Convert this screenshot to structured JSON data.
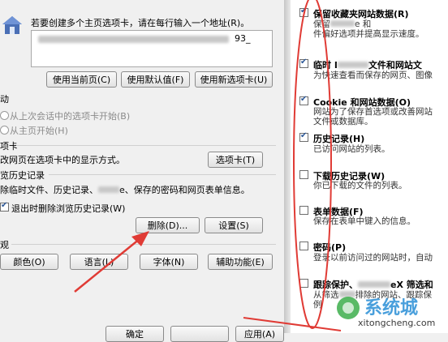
{
  "left": {
    "home_text": "若要创建多个主页选项卡，请在每行输入一个地址(R)。",
    "url_suffix": "93_",
    "btn_current": "使用当前页(C)",
    "btn_default": "使用默认值(F)",
    "btn_newtab": "使用新选项卡(U)",
    "startup_head": "动",
    "startup_opt1": "从上次会话中的选项卡开始(B)",
    "startup_opt2": "从主页开始(H)",
    "tabs_head": "项卡",
    "tabs_desc": "改网页在选项卡中的显示方式。",
    "btn_tabs": "选项卡(T)",
    "history_head": "览历史记录",
    "history_desc_a": "除临时文件、历史记录、",
    "history_desc_b": "e、保存的密码和网页表单信息。",
    "delete_on_exit": "退出时删除浏览历史记录(W)",
    "btn_delete": "删除(D)...",
    "btn_settings": "设置(S)",
    "appearance_head": "观",
    "btn_color": "颜色(O)",
    "btn_language": "语言(L)",
    "btn_font": "字体(N)",
    "btn_access": "辅助功能(E)",
    "btn_ok": "确定",
    "btn_apply": "应用(A)"
  },
  "right": {
    "items": [
      {
        "title": "保留收藏夹网站数据(R)",
        "desc": [
          "保留",
          "e 和",
          "件偏好选项并提高显示速度。"
        ],
        "checked": true
      },
      {
        "title_a": "临时 I",
        "title_b": "文件和网站文",
        "desc": [
          "为快速查看而保存的网页、图像"
        ],
        "checked": true
      },
      {
        "title": "Cookie 和网站数据(O)",
        "desc": [
          "网站为了保存首选项或改善网站",
          "文件或数据库。"
        ],
        "checked": true
      },
      {
        "title": "历史记录(H)",
        "desc": [
          "已访问网站的列表。"
        ],
        "checked": true
      },
      {
        "title": "下载历史记录(W)",
        "desc": [
          "你已下载的文件的列表。"
        ],
        "checked": false
      },
      {
        "title": "表单数据(F)",
        "desc": [
          "保存在表单中键入的信息。"
        ],
        "checked": false
      },
      {
        "title": "密码(P)",
        "desc": [
          "登录以前访问过的网站时，自动"
        ],
        "checked": false
      },
      {
        "title_a": "跟踪保护、",
        "title_b": "eX 筛选和",
        "desc": [
          "从筛选",
          "排除的网站、跟踪保",
          "例"
        ],
        "checked": false
      }
    ]
  },
  "watermark": {
    "brand": "系统城",
    "url": "xitongcheng.com"
  },
  "colors": {
    "annotation": "#e03b35",
    "check": "#2b5797"
  }
}
